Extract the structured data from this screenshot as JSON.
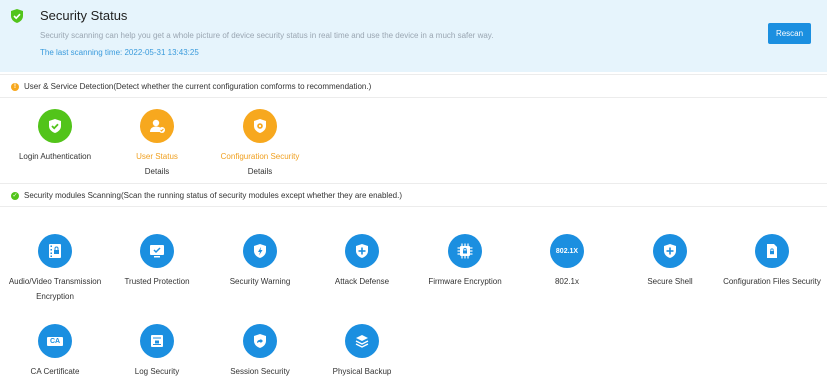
{
  "header": {
    "title": "Security Status",
    "description": "Security scanning can help you get a whole picture of device security status in real time and use the device in a much safer way.",
    "last_scan": "The last scanning time: 2022-05-31 13:43:25",
    "rescan_label": "Rescan"
  },
  "detection": {
    "title": "User & Service Detection(Detect whether the current configuration comforms to recommendation.)",
    "items": [
      {
        "label": "Login Authentication",
        "status": "ok",
        "icon": "shield-check-icon"
      },
      {
        "label": "User Status",
        "status": "warning",
        "details": "Details",
        "icon": "user-check-icon"
      },
      {
        "label": "Configuration Security",
        "status": "warning",
        "details": "Details",
        "icon": "shield-gear-icon"
      }
    ]
  },
  "modules": {
    "title": "Security modules Scanning(Scan the running status of security modules except whether they are enabled.)",
    "items": [
      {
        "label": "Audio/Video Transmission Encryption",
        "icon": "film-lock-icon"
      },
      {
        "label": "Trusted Protection",
        "icon": "monitor-check-icon"
      },
      {
        "label": "Security Warning",
        "icon": "shield-bolt-icon"
      },
      {
        "label": "Attack Defense",
        "icon": "shield-plus-icon"
      },
      {
        "label": "Firmware Encryption",
        "icon": "chip-lock-icon"
      },
      {
        "label": "802.1x",
        "badge": "802.1X",
        "icon": "8021x-icon"
      },
      {
        "label": "Secure Shell",
        "icon": "shield-plus-icon"
      },
      {
        "label": "Configuration Files Security",
        "icon": "file-lock-icon"
      },
      {
        "label": "CA Certificate",
        "badge": "CA",
        "icon": "ca-certificate-icon"
      },
      {
        "label": "Log Security",
        "icon": "log-lock-icon"
      },
      {
        "label": "Session Security",
        "icon": "session-shield-icon"
      },
      {
        "label": "Physical Backup",
        "icon": "layers-icon"
      }
    ]
  },
  "colors": {
    "ok": "#52c41a",
    "warning": "#f7a81e",
    "module": "#1b8fe0",
    "accent": "#1b8fe0"
  }
}
